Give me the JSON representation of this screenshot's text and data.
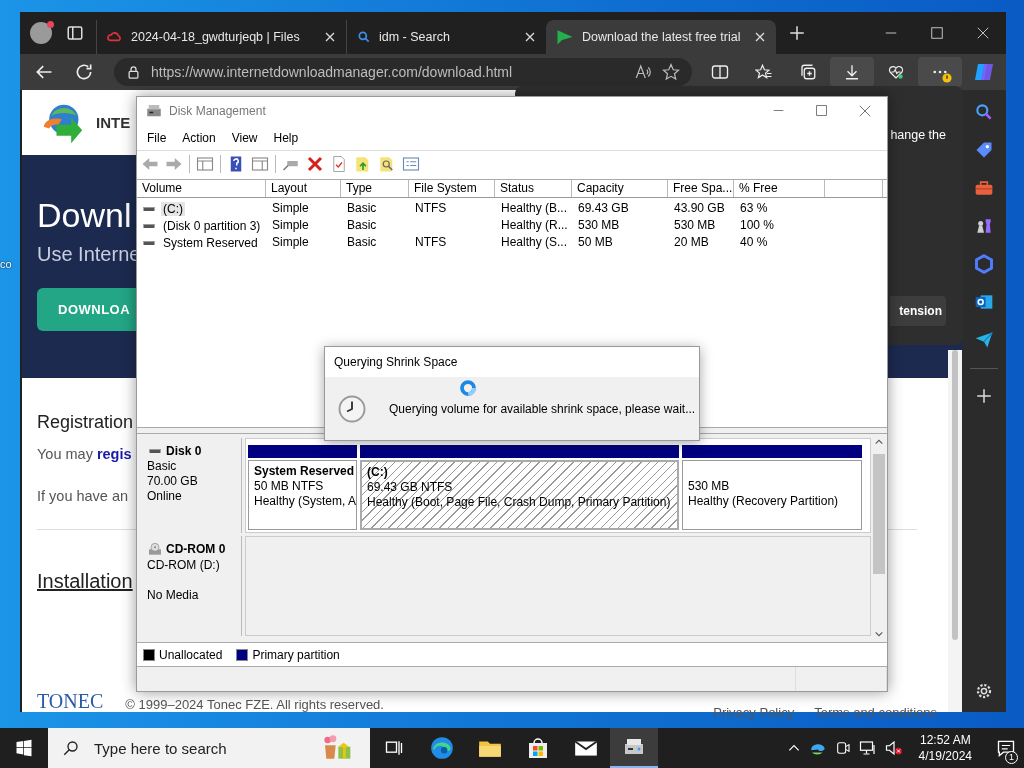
{
  "desktop": {
    "icon_labels": [
      {
        "label": "co"
      }
    ]
  },
  "browser": {
    "tabs": [
      {
        "title": "2024-04-18_gwdturjeqb | Files",
        "kind": "cloud",
        "selected": false
      },
      {
        "title": "idm - Search",
        "kind": "search",
        "selected": false
      },
      {
        "title": "Download the latest free trial",
        "kind": "idm",
        "selected": true
      }
    ],
    "url": "https://www.internetdownloadmanager.com/download.html"
  },
  "flyout": {
    "text": "hange the",
    "button": "tension"
  },
  "web_page": {
    "brand": "INTE",
    "heading": "Downl",
    "subheading": "Use Interne",
    "download_button": "DOWNLOA",
    "registration_title": "Registration",
    "registration_text": "You may",
    "registration_link": "regis",
    "registration_note": "If you have an",
    "installation_title": "Installation",
    "footer_logo": "TONEC",
    "copyright": "© 1999–2024 Tonec FZE. All rights reserved.",
    "footer_links": [
      "Privacy Policy",
      "Terms and conditions"
    ]
  },
  "disk_management": {
    "title": "Disk Management",
    "menu": [
      "File",
      "Action",
      "View",
      "Help"
    ],
    "columns": [
      "Volume",
      "Layout",
      "Type",
      "File System",
      "Status",
      "Capacity",
      "Free Spa...",
      "% Free"
    ],
    "rows": [
      {
        "cells": [
          "(C:)",
          "Simple",
          "Basic",
          "NTFS",
          "Healthy (B...",
          "69.43 GB",
          "43.90 GB",
          "63 %"
        ],
        "selected": true
      },
      {
        "cells": [
          "(Disk 0 partition 3)",
          "Simple",
          "Basic",
          "",
          "Healthy (R...",
          "530 MB",
          "530 MB",
          "100 %"
        ],
        "selected": false
      },
      {
        "cells": [
          "System Reserved",
          "Simple",
          "Basic",
          "NTFS",
          "Healthy (S...",
          "50 MB",
          "20 MB",
          "40 %"
        ],
        "selected": false
      }
    ],
    "disks": [
      {
        "name": "Disk 0",
        "kind": "disk",
        "type": "Basic",
        "size": "70.00 GB",
        "status": "Online",
        "partitions": [
          {
            "name": "System Reserved",
            "size": "50 MB NTFS",
            "status": "Healthy (System, A",
            "selected": false
          },
          {
            "name": "(C:)",
            "size": "69.43 GB NTFS",
            "status": "Healthy (Boot, Page File, Crash Dump, Primary Partition)",
            "selected": true
          },
          {
            "size": "530 MB",
            "status": "Healthy (Recovery Partition)",
            "selected": false
          }
        ]
      },
      {
        "name": "CD-ROM 0",
        "kind": "cdrom",
        "type": "CD-ROM (D:)",
        "status": "No Media"
      }
    ],
    "legend": [
      {
        "label": "Unallocated",
        "color": "#000000"
      },
      {
        "label": "Primary partition",
        "color": "#000080"
      }
    ]
  },
  "dialog": {
    "title": "Querying Shrink Space",
    "message": "Querying volume for available shrink space, please wait..."
  },
  "taskbar": {
    "search": {
      "placeholder": "Type here to search"
    },
    "apps": [
      {
        "kind": "task-view",
        "active": false
      },
      {
        "kind": "edge",
        "active": false
      },
      {
        "kind": "explorer",
        "active": false
      },
      {
        "kind": "store",
        "active": false
      },
      {
        "kind": "mail",
        "active": false
      },
      {
        "kind": "disk",
        "active": true
      }
    ],
    "time": "12:52 AM",
    "date": "4/19/2024",
    "notification_count": "1"
  }
}
